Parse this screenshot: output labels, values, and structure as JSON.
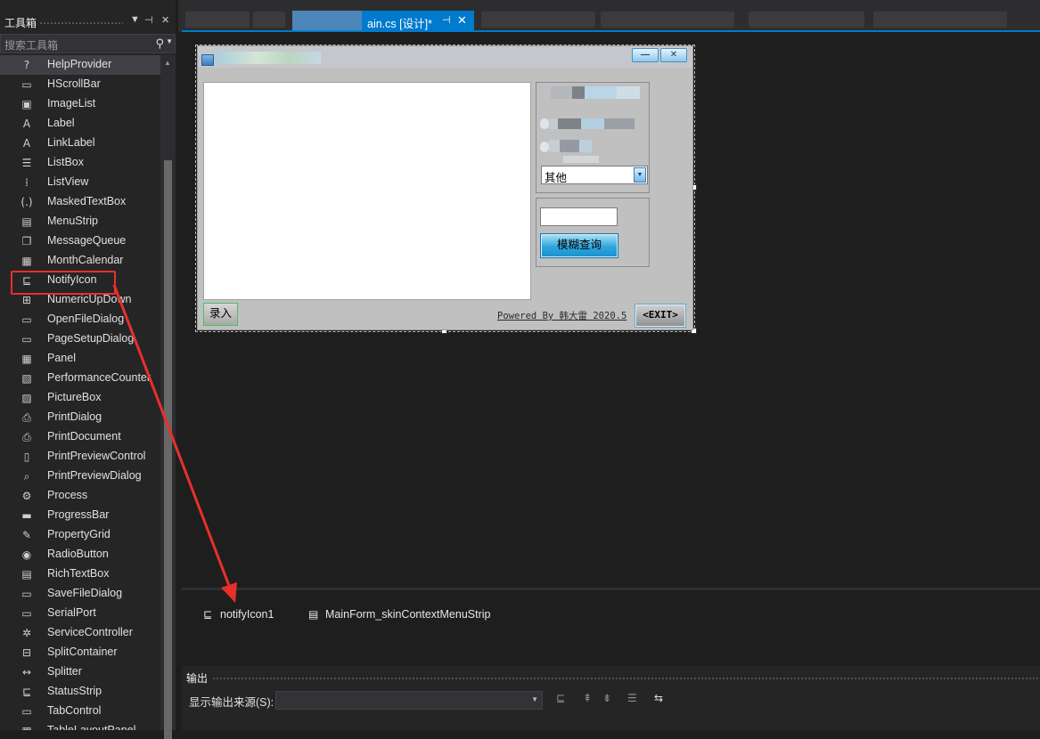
{
  "toolbox": {
    "title": "工具箱",
    "search_placeholder": "搜索工具箱",
    "items": [
      {
        "label": "HelpProvider",
        "icon": "help-icon",
        "glyph": "?"
      },
      {
        "label": "HScrollBar",
        "icon": "hscrollbar-icon",
        "glyph": "▭"
      },
      {
        "label": "ImageList",
        "icon": "imagelist-icon",
        "glyph": "▣"
      },
      {
        "label": "Label",
        "icon": "label-icon",
        "glyph": "A"
      },
      {
        "label": "LinkLabel",
        "icon": "linklabel-icon",
        "glyph": "A"
      },
      {
        "label": "ListBox",
        "icon": "listbox-icon",
        "glyph": "☰"
      },
      {
        "label": "ListView",
        "icon": "listview-icon",
        "glyph": "⁞"
      },
      {
        "label": "MaskedTextBox",
        "icon": "maskedtextbox-icon",
        "glyph": "(.)"
      },
      {
        "label": "MenuStrip",
        "icon": "menustrip-icon",
        "glyph": "▤"
      },
      {
        "label": "MessageQueue",
        "icon": "messagequeue-icon",
        "glyph": "❐"
      },
      {
        "label": "MonthCalendar",
        "icon": "monthcalendar-icon",
        "glyph": "▦"
      },
      {
        "label": "NotifyIcon",
        "icon": "notifyicon-icon",
        "glyph": "⊑"
      },
      {
        "label": "NumericUpDown",
        "icon": "numericupdown-icon",
        "glyph": "⊞"
      },
      {
        "label": "OpenFileDialog",
        "icon": "openfiledialog-icon",
        "glyph": "▭"
      },
      {
        "label": "PageSetupDialog",
        "icon": "pagesetupdialog-icon",
        "glyph": "▭"
      },
      {
        "label": "Panel",
        "icon": "panel-icon",
        "glyph": "▦"
      },
      {
        "label": "PerformanceCounter",
        "icon": "performancecounter-icon",
        "glyph": "▧"
      },
      {
        "label": "PictureBox",
        "icon": "picturebox-icon",
        "glyph": "▨"
      },
      {
        "label": "PrintDialog",
        "icon": "printdialog-icon",
        "glyph": "⎙"
      },
      {
        "label": "PrintDocument",
        "icon": "printdocument-icon",
        "glyph": "⎙"
      },
      {
        "label": "PrintPreviewControl",
        "icon": "printpreviewcontrol-icon",
        "glyph": "▯"
      },
      {
        "label": "PrintPreviewDialog",
        "icon": "printpreviewdialog-icon",
        "glyph": "⌕"
      },
      {
        "label": "Process",
        "icon": "process-icon",
        "glyph": "⚙"
      },
      {
        "label": "ProgressBar",
        "icon": "progressbar-icon",
        "glyph": "▬"
      },
      {
        "label": "PropertyGrid",
        "icon": "propertygrid-icon",
        "glyph": "✎"
      },
      {
        "label": "RadioButton",
        "icon": "radiobutton-icon",
        "glyph": "◉"
      },
      {
        "label": "RichTextBox",
        "icon": "richtextbox-icon",
        "glyph": "▤"
      },
      {
        "label": "SaveFileDialog",
        "icon": "savefiledialog-icon",
        "glyph": "▭"
      },
      {
        "label": "SerialPort",
        "icon": "serialport-icon",
        "glyph": "▭"
      },
      {
        "label": "ServiceController",
        "icon": "servicecontroller-icon",
        "glyph": "✲"
      },
      {
        "label": "SplitContainer",
        "icon": "splitcontainer-icon",
        "glyph": "⊟"
      },
      {
        "label": "Splitter",
        "icon": "splitter-icon",
        "glyph": "↔"
      },
      {
        "label": "StatusStrip",
        "icon": "statusstrip-icon",
        "glyph": "⊑"
      },
      {
        "label": "TabControl",
        "icon": "tabcontrol-icon",
        "glyph": "▭"
      },
      {
        "label": "TableLayoutPanel",
        "icon": "tablelayoutpanel-icon",
        "glyph": "▦"
      }
    ]
  },
  "tabs": {
    "active_label": "ain.cs [设计]*",
    "pin_glyph": "⊣",
    "close_glyph": "✕"
  },
  "form": {
    "min_glyph": "—",
    "close_glyph": "✕",
    "combo_value": "其他",
    "fuzzy_button": "模糊查询",
    "enter_button": "录入",
    "powered_text": "Powered By 韩大雷 2020.5",
    "exit_button": "<EXIT>"
  },
  "tray": {
    "items": [
      {
        "label": "notifyIcon1",
        "icon": "notifyicon-icon",
        "glyph": "⊑"
      },
      {
        "label": "MainForm_skinContextMenuStrip",
        "icon": "contextmenustrip-icon",
        "glyph": "▤"
      }
    ]
  },
  "output": {
    "title": "输出",
    "source_label": "显示输出来源(S):",
    "source_value": ""
  },
  "colors": {
    "accent": "#007acc",
    "annotation": "#e8302a"
  }
}
